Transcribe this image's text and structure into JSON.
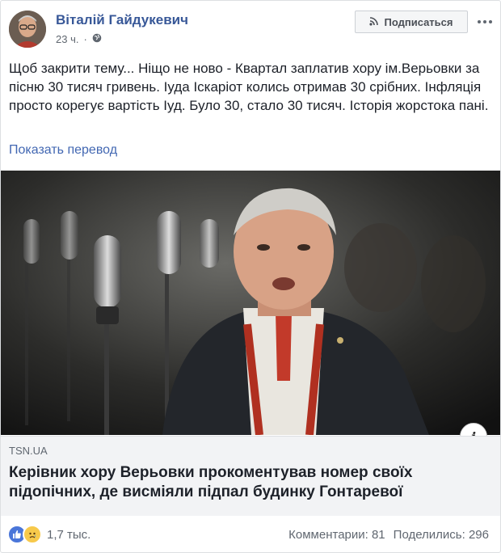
{
  "post": {
    "author": "Віталій Гайдукевич",
    "time": "23 ч.",
    "subscribe_label": "Подписаться",
    "text": "Щоб закрити тему... Ніщо не ново - Квартал заплатив хору ім.Верьовки за пісню 30 тисяч гривень. Іуда Іскаріот колись отримав 30 срібних. Інфляція просто корегує вартість Іуд. Було 30, стало 30 тисяч. Історія жорстока пані.",
    "translate_link": "Показать перевод"
  },
  "link": {
    "domain": "TSN.UA",
    "headline": "Керівник хору Верьовки прокоментував номер своїх підопічних, де висміяли підпал будинку Гонтаревої"
  },
  "footer": {
    "reaction_count": "1,7 тыс.",
    "comments": "Комментарии: 81",
    "shares": "Поделились: 296"
  },
  "colors": {
    "author_link": "#385898",
    "translate_link": "#4267b2",
    "like": "#4a76d9",
    "sad": "#f7c94b"
  },
  "icons": [
    "rss-icon",
    "globe-icon",
    "more-icon",
    "info-icon",
    "like-icon",
    "sad-icon"
  ]
}
